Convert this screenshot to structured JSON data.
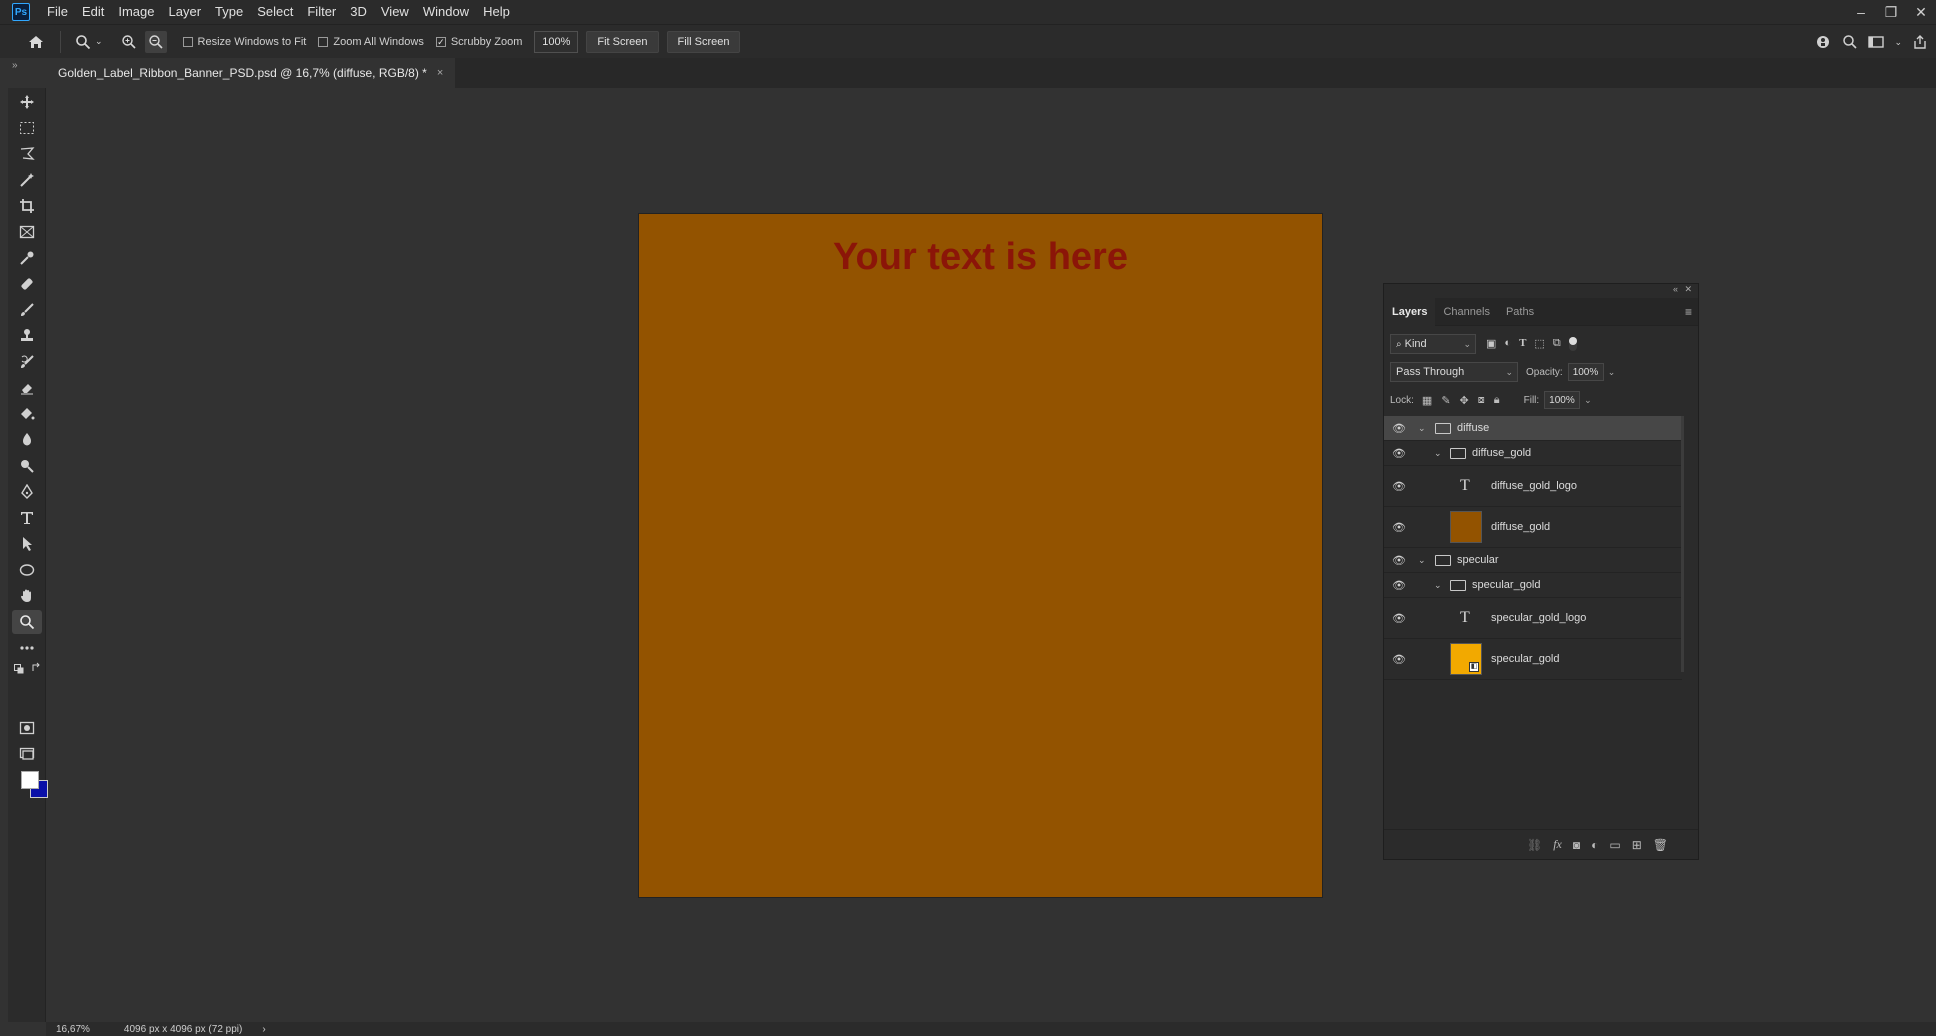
{
  "app": {
    "logo": "Ps"
  },
  "menu": [
    "File",
    "Edit",
    "Image",
    "Layer",
    "Type",
    "Select",
    "Filter",
    "3D",
    "View",
    "Window",
    "Help"
  ],
  "window_controls": {
    "minimize": "–",
    "restore": "❐",
    "close": "✕"
  },
  "options": {
    "resize_windows": "Resize Windows to Fit",
    "zoom_all": "Zoom All Windows",
    "scrubby_zoom": "Scrubby Zoom",
    "zoom_value": "100%",
    "fit_screen": "Fit Screen",
    "fill_screen": "Fill Screen",
    "resize_checked": false,
    "zoom_all_checked": false,
    "scrubby_checked": true
  },
  "document_tab": {
    "title": "Golden_Label_Ribbon_Banner_PSD.psd @ 16,7% (diffuse, RGB/8) *",
    "close": "×"
  },
  "canvas": {
    "text": "Your text is here",
    "background": "#935300",
    "text_color": "#8b1508"
  },
  "colors": {
    "foreground": "#ffffff",
    "background": "#0a10a8"
  },
  "layers_panel": {
    "tabs": [
      "Layers",
      "Channels",
      "Paths"
    ],
    "filter_kind": "Kind",
    "blend_mode": "Pass Through",
    "opacity_label": "Opacity:",
    "opacity_value": "100%",
    "lock_label": "Lock:",
    "fill_label": "Fill:",
    "fill_value": "100%",
    "layers": [
      {
        "name": "diffuse",
        "type": "group",
        "level": 0
      },
      {
        "name": "diffuse_gold",
        "type": "group",
        "level": 1
      },
      {
        "name": "diffuse_gold_logo",
        "type": "text",
        "level": 2
      },
      {
        "name": "diffuse_gold",
        "type": "pixel",
        "level": 2,
        "thumb_color": "#935300"
      },
      {
        "name": "specular",
        "type": "group",
        "level": 0
      },
      {
        "name": "specular_gold",
        "type": "group",
        "level": 1
      },
      {
        "name": "specular_gold_logo",
        "type": "text",
        "level": 2
      },
      {
        "name": "specular_gold",
        "type": "smart",
        "level": 2,
        "thumb_color": "#f2a900"
      }
    ]
  },
  "status": {
    "zoom": "16,67%",
    "doc_info": "4096 px x 4096 px (72 ppi)",
    "arrow": "›"
  }
}
